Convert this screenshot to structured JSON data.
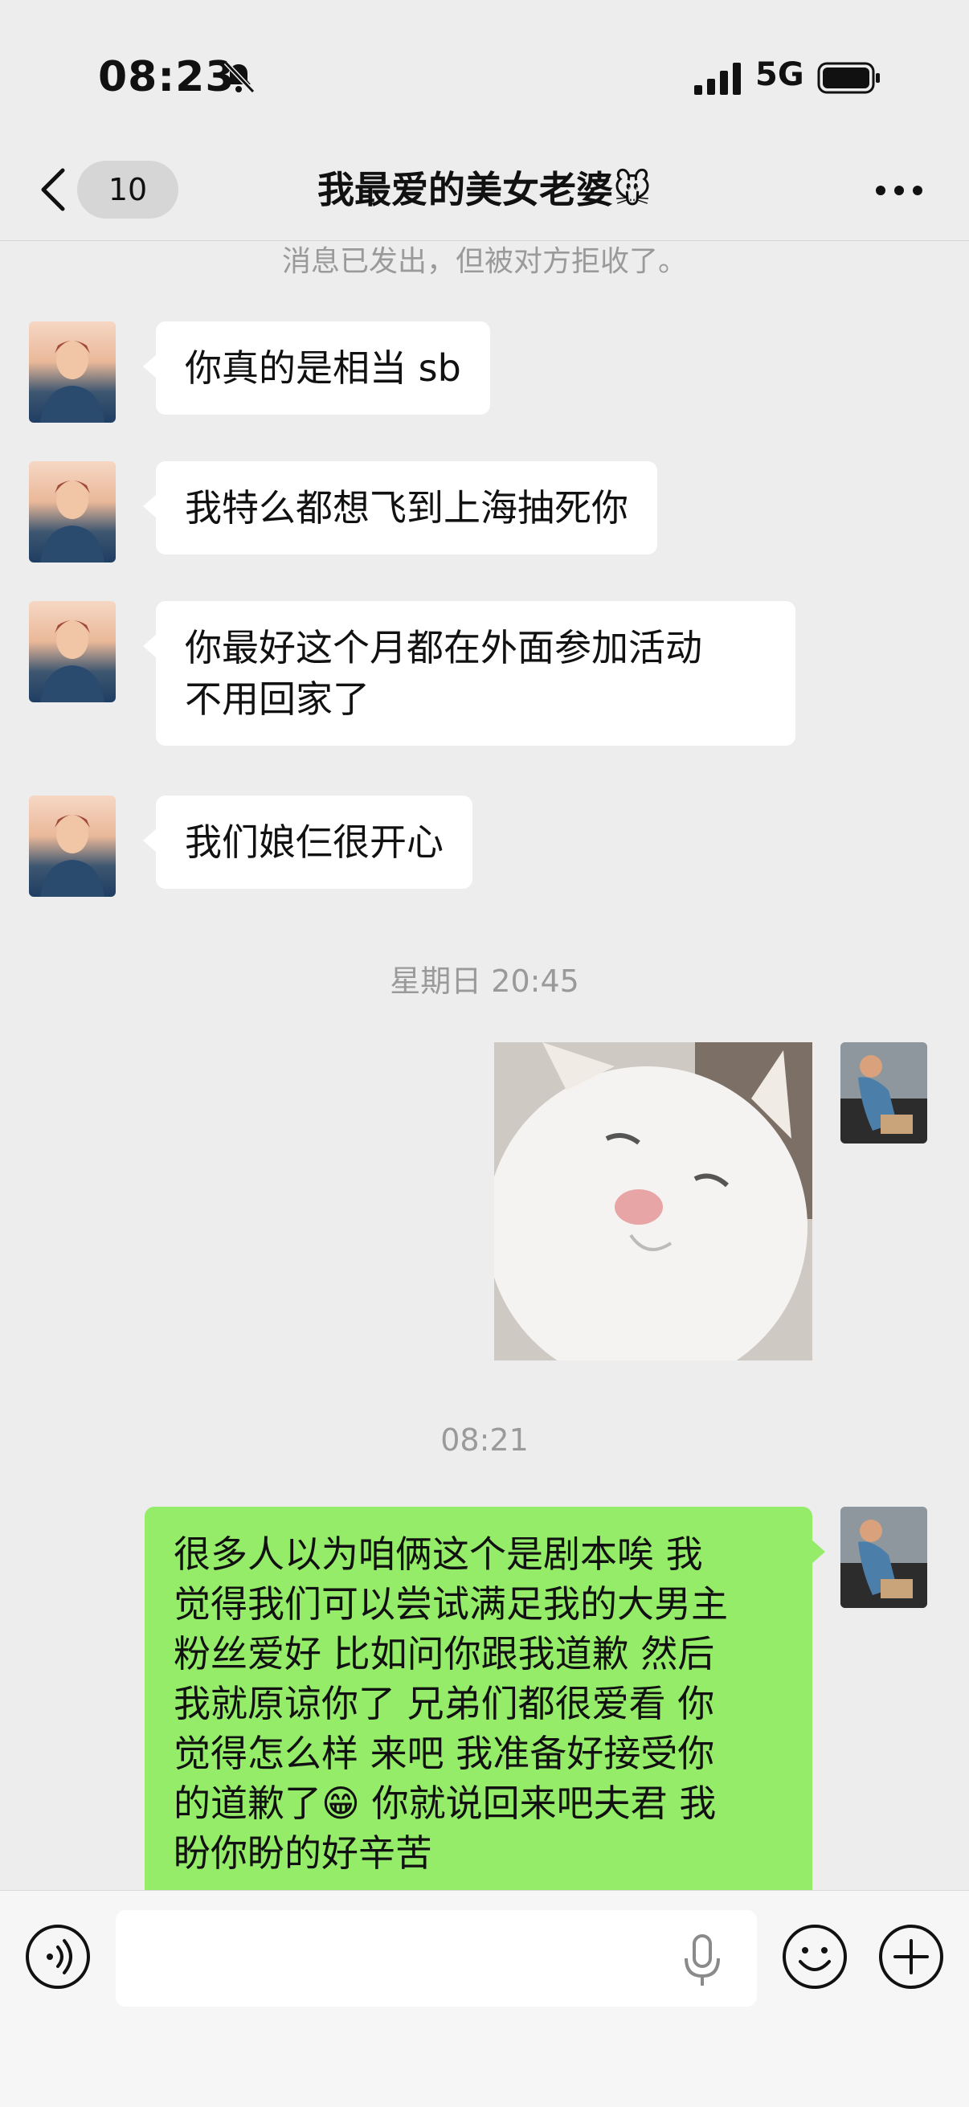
{
  "status_bar": {
    "time": "08:23",
    "network": "5G",
    "icons": [
      "bell-slash-icon",
      "signal-icon",
      "battery-icon"
    ]
  },
  "nav": {
    "unread_count": "10",
    "title": "我最爱的美女老婆🐭",
    "icons": [
      "chevron-left-icon",
      "more-icon"
    ]
  },
  "notice": "消息已发出，但被对方拒收了。",
  "messages": [
    {
      "side": "left",
      "text": "你真的是相当 sb"
    },
    {
      "side": "left",
      "text": "我特么都想飞到上海抽死你"
    },
    {
      "side": "left",
      "line1": "你最好这个月都在外面参加活动",
      "line2": "不用回家了"
    },
    {
      "side": "left",
      "text": "我们娘仨很开心"
    },
    {
      "timestamp": "星期日 20:45"
    },
    {
      "side": "right",
      "type": "sticker",
      "subject": "white cat"
    },
    {
      "timestamp": "08:21"
    },
    {
      "side": "right",
      "lines": [
        "很多人以为咱俩这个是剧本唉 我",
        "觉得我们可以尝试满足我的大男主",
        "粉丝爱好 比如问你跟我道歉 然后",
        "我就原谅你了 兄弟们都很爱看 你",
        "觉得怎么样 来吧 我准备好接受你",
        "的道歉了😁 你就说回来吧夫君 我",
        "盼你盼的好辛苦"
      ]
    }
  ],
  "input_bar": {
    "text_value": "",
    "icons": [
      "voice-icon",
      "mic-icon",
      "emoji-icon",
      "plus-icon"
    ]
  },
  "colors": {
    "background": "#ededed",
    "bubble_self": "#95ec69",
    "bubble_other": "#ffffff",
    "muted_text": "#9a9a9a"
  }
}
